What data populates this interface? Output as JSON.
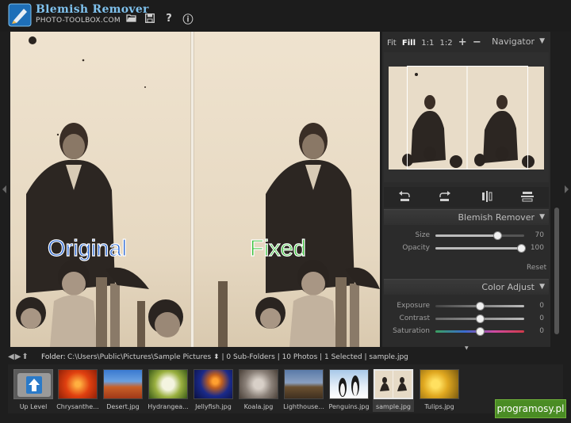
{
  "header": {
    "title": "Blemish Remover",
    "subtitle": "PHOTO-TOOLBOX.COM",
    "icons": [
      "folder-open-icon",
      "save-icon",
      "help-icon",
      "info-icon"
    ],
    "help_glyph": "?",
    "info_glyph": "ⓘ"
  },
  "viewer": {
    "label_original": "Original",
    "label_fixed": "Fixed",
    "colors": {
      "original": "#1f5fd0",
      "fixed": "#39c03a"
    }
  },
  "navigator": {
    "title": "Navigator",
    "zoom_options": [
      "Fit",
      "Fill",
      "1:1",
      "1:2",
      "+",
      "−"
    ],
    "active_zoom": "Fill"
  },
  "tools": [
    "rotate-left-icon",
    "rotate-right-icon",
    "flip-horizontal-icon",
    "flip-vertical-icon"
  ],
  "blemish_remover": {
    "title": "Blemish Remover",
    "size_label": "Size",
    "size_value": "70",
    "size_fraction": 0.7,
    "opacity_label": "Opacity",
    "opacity_value": "100",
    "opacity_fraction": 1.0,
    "reset_label": "Reset"
  },
  "color_adjust": {
    "title": "Color Adjust",
    "exposure_label": "Exposure",
    "exposure_value": "0",
    "contrast_label": "Contrast",
    "contrast_value": "0",
    "saturation_label": "Saturation",
    "saturation_value": "0"
  },
  "path_bar": {
    "folder_label": "Folder:",
    "path": "C:\\Users\\Public\\Pictures\\Sample Pictures",
    "stats": "| 0 Sub-Folders | 10 Photos | 1 Selected | sample.jpg"
  },
  "filmstrip": {
    "items": [
      {
        "label": "Up Level"
      },
      {
        "label": "Chrysanthe..."
      },
      {
        "label": "Desert.jpg"
      },
      {
        "label": "Hydrangea..."
      },
      {
        "label": "Jellyfish.jpg"
      },
      {
        "label": "Koala.jpg"
      },
      {
        "label": "Lighthouse..."
      },
      {
        "label": "Penguins.jpg"
      },
      {
        "label": "sample.jpg"
      },
      {
        "label": "Tulips.jpg"
      }
    ],
    "selected": "sample.jpg"
  },
  "watermark": "programosy.pl"
}
